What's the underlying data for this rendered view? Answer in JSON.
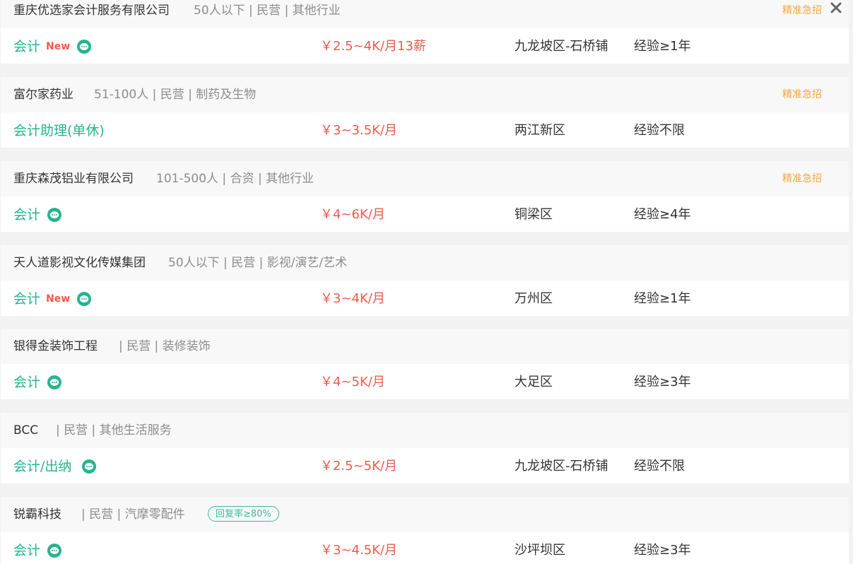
{
  "listings": [
    {
      "company": "重庆优选家会计服务有限公司",
      "meta": "50人以下 | 民营 | 其他行业",
      "tag": "精准急招",
      "title": "会计",
      "is_new": true,
      "new_label": "New",
      "salary": "￥2.5~4K/月13薪",
      "location": "九龙坡区-石桥铺",
      "experience": "经验≥1年",
      "closable": true
    },
    {
      "company": "富尔家药业",
      "meta": "51-100人 | 民营 | 制药及生物",
      "tag": "精准急招",
      "title": "会计助理(单休)",
      "is_new": false,
      "salary": "￥3~3.5K/月",
      "location": "两江新区",
      "experience": "经验不限"
    },
    {
      "company": "重庆森茂铝业有限公司",
      "meta": "101-500人 | 合资 | 其他行业",
      "tag": "精准急招",
      "title": "会计",
      "is_new": false,
      "salary": "￥4~6K/月",
      "location": "铜梁区",
      "experience": "经验≥4年"
    },
    {
      "company": "天人道影视文化传媒集团",
      "meta": "50人以下 | 民营 | 影视/演艺/艺术",
      "tag": "",
      "title": "会计",
      "is_new": true,
      "new_label": "New",
      "salary": "￥3~4K/月",
      "location": "万州区",
      "experience": "经验≥1年"
    },
    {
      "company": "银得金装饰工程",
      "meta": "| 民营 | 装修装饰",
      "tag": "",
      "title": "会计",
      "is_new": false,
      "salary": "￥4~5K/月",
      "location": "大足区",
      "experience": "经验≥3年"
    },
    {
      "company": "BCC",
      "meta": "| 民营 | 其他生活服务",
      "tag": "",
      "title": "会计/出纳",
      "is_new": false,
      "salary": "￥2.5~5K/月",
      "location": "九龙坡区-石桥铺",
      "experience": "经验不限"
    },
    {
      "company": "锐霸科技",
      "meta": "| 民营 | 汽摩零配件",
      "badge": "回复率≥80%",
      "tag": "",
      "title": "会计",
      "is_new": false,
      "salary": "￥3~4.5K/月",
      "location": "沙坪坝区",
      "experience": "经验≥3年"
    }
  ],
  "colors": {
    "accent": "#25b58f",
    "salary": "#f05a4b",
    "urgent_tag": "#f4a63a",
    "badge": "#3dbd9b"
  },
  "icons": {
    "chat": "chat-bubble-icon",
    "close": "close-icon"
  }
}
